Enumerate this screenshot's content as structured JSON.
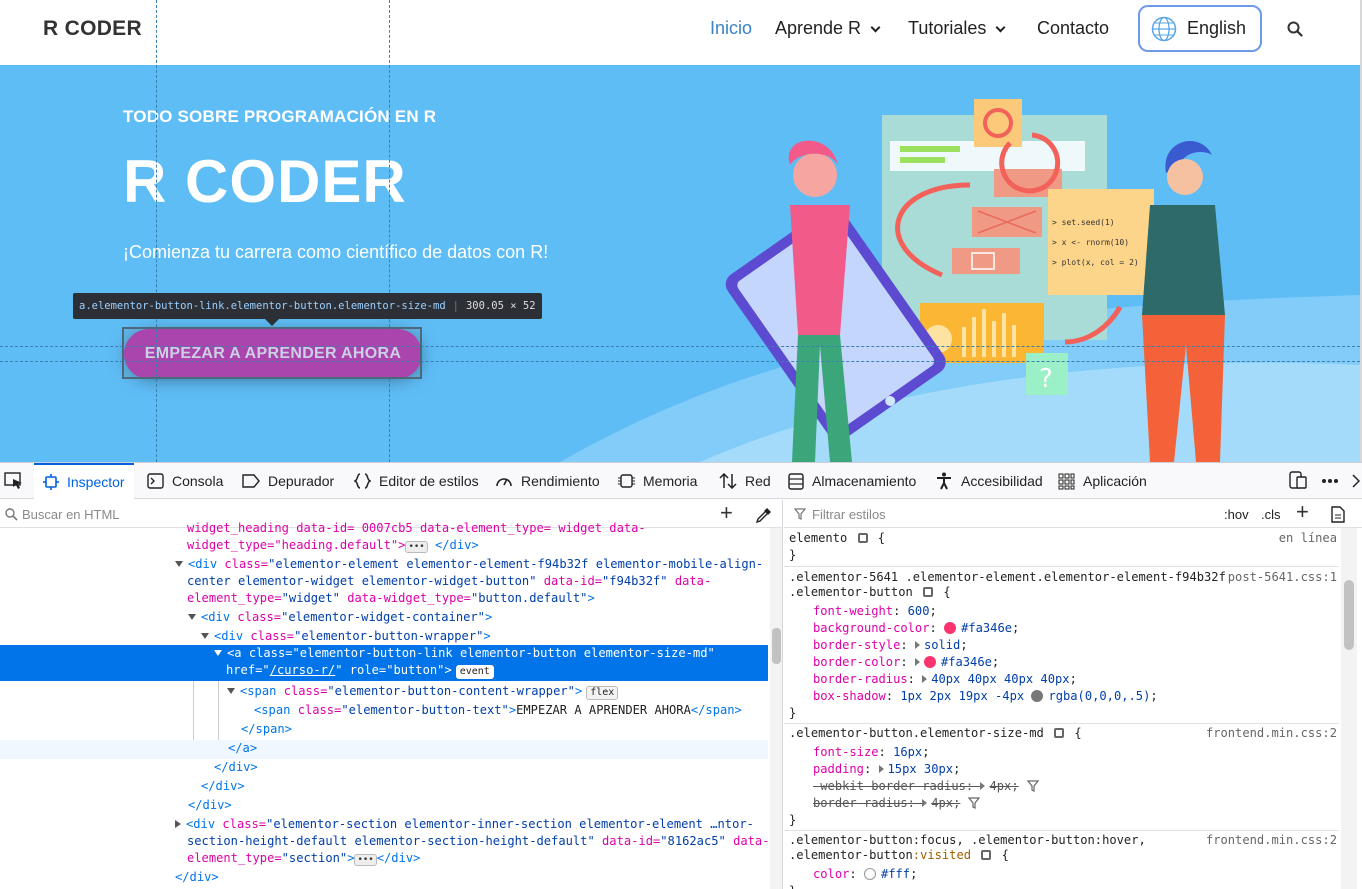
{
  "site": {
    "logo": "R CODER",
    "nav": {
      "home": "Inicio",
      "learn": "Aprende R",
      "tutorials": "Tutoriales",
      "contact": "Contacto",
      "language": "English"
    },
    "hero": {
      "kicker": "TODO SOBRE PROGRAMACIÓN EN R",
      "title": "R CODER",
      "subtitle": "¡Comienza tu carrera como científico de datos con R!",
      "cta": "EMPEZAR A APRENDER AHORA",
      "code_lines": [
        "> set.seed(1)",
        "> x <- rnorm(10)",
        "> plot(x, col = 2)"
      ]
    }
  },
  "highlight": {
    "selector": "a.elementor-button-link.elementor-button.elementor-size-md",
    "dimensions": "300.05 × 52"
  },
  "devtools": {
    "tabs": {
      "inspector": "Inspector",
      "console": "Consola",
      "debugger": "Depurador",
      "style_editor": "Editor de estilos",
      "performance": "Rendimiento",
      "memory": "Memoria",
      "network": "Red",
      "storage": "Almacenamiento",
      "accessibility": "Accesibilidad",
      "application": "Aplicación"
    },
    "html_search_placeholder": "Buscar en HTML",
    "styles_filter_placeholder": "Filtrar estilos",
    "hov": ":hov",
    "cls": ".cls",
    "tree": {
      "r0": "widget_heading  data-id= 0007cb5  data-element_type= widget  data-",
      "r1a": "widget_type=\"heading.default\">",
      "r1b": "</div>",
      "r2_tag": "<div",
      "r2_attr": "class=",
      "r2_val": "\"elementor-element elementor-element-f94b32f elementor-mobile-align-",
      "r3_val": "center elementor-widget elementor-widget-button\"",
      "r3_attr": "data-id=",
      "r3_val2": "\"f94b32f\"",
      "r3_attr2": "data-",
      "r4_attr": "element_type=",
      "r4_val": "\"widget\"",
      "r4_attr2": "data-widget_type=",
      "r4_val2": "\"button.default\"",
      "r4_end": ">",
      "r5": "<div",
      "r5_attr": "class=",
      "r5_val": "\"elementor-widget-container\"",
      "r6_val": "\"elementor-button-wrapper\"",
      "r7_tag": "<a",
      "r7_val": "\"elementor-button-link elementor-button elementor-size-md\"",
      "r8_attr": "href=",
      "r8_url": "/curso-r/",
      "r8_attr2": "role=",
      "r8_val": "\"button\"",
      "r8_badge": "event",
      "r9_tag": "<span",
      "r9_val": "\"elementor-button-content-wrapper\"",
      "r9_badge": "flex",
      "r10_val": "\"elementor-button-text\"",
      "r10_text": "EMPEZAR A APRENDER AHORA",
      "r10_close": "</span>",
      "r11": "</span>",
      "r12": "</a>",
      "r13": "</div>",
      "r14": "</div>",
      "r15": "</div>",
      "r16_val": "\"elementor-section elementor-inner-section elementor-element …ntor-",
      "r17_val": "section-height-default elementor-section-height-default\"",
      "r17_attr": "data-id=",
      "r17_val2": "\"8162ac5\"",
      "r17_attr2": "data-",
      "r18_attr": "element_type=",
      "r18_val": "\"section\"",
      "r18_end": "</div>",
      "r19": "</div>"
    },
    "rules": {
      "element_selector": "elemento",
      "element_src": "en línea",
      "r2_selector_a": ".elementor-5641 .elementor-element.elementor-element-f94b32f",
      "r2_selector_b": ".elementor-button",
      "r2_src": "post-5641.css:1",
      "r2_decls": [
        {
          "prop": "font-weight",
          "val": "600"
        },
        {
          "prop": "background-color",
          "val": "#fa346e"
        },
        {
          "prop": "border-style",
          "val": "solid"
        },
        {
          "prop": "border-color",
          "val": "#fa346e"
        },
        {
          "prop": "border-radius",
          "val": "40px 40px 40px 40px"
        },
        {
          "prop": "box-shadow",
          "val": "1px 2px 19px -4px",
          "val2": "rgba(0,0,0,.5)"
        }
      ],
      "r3_selector": ".elementor-button.elementor-size-md",
      "r3_src": "frontend.min.css:2",
      "r3_decls": [
        {
          "prop": "font-size",
          "val": "16px"
        },
        {
          "prop": "padding",
          "val": "15px 30px"
        },
        {
          "prop": "-webkit-border-radius",
          "val": "4px"
        },
        {
          "prop": "border-radius",
          "val": "4px"
        }
      ],
      "r4_selector_a": ".elementor-button:focus, .elementor-button:hover,",
      "r4_selector_b": ".elementor-button",
      "r4_selector_c": ":visited",
      "r4_src": "frontend.min.css:2",
      "r4_decls": [
        {
          "prop": "color",
          "val": "#fff"
        }
      ]
    }
  },
  "colors": {
    "accent": "#0074e8",
    "hero_bg": "#5fbdf6",
    "brand_pink": "#fa346e"
  }
}
